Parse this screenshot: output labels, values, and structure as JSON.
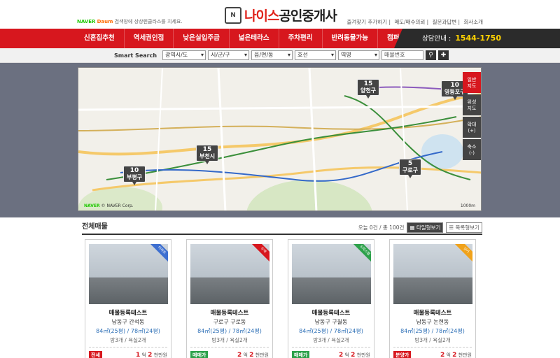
{
  "header": {
    "naver_brand": "NAVER",
    "naver_sub": "Daum",
    "naver_note": "검색창에 상상렌클라스를 치세요.",
    "logo_mark": "N",
    "logo_red": "나이스",
    "logo_dark": "공인중개사",
    "links": [
      "즐겨찾기 추가하기",
      "매도/매수의뢰",
      "질문과답변",
      "회사소개"
    ]
  },
  "nav": {
    "items": [
      "신혼집추천",
      "역세권인접",
      "낮은실입주금",
      "넓은테라스",
      "주차편리",
      "반려동물가능",
      "캠퍼스인접"
    ],
    "call_label": "상담안내 :",
    "call_number": "1544-1750"
  },
  "search": {
    "label": "Smart Search",
    "selects": [
      "광역시/도",
      "시/군/구",
      "읍/면/동",
      "호선",
      "역명"
    ],
    "input_placeholder": "매물번호",
    "search_icon": "search-icon",
    "reset_icon": "plus-icon"
  },
  "map": {
    "pins": [
      {
        "count": "15",
        "name": "양천구"
      },
      {
        "count": "10",
        "name": "영등포구"
      },
      {
        "count": "15",
        "name": "부천시"
      },
      {
        "count": "10",
        "name": "부평구"
      },
      {
        "count": "5",
        "name": "구로구"
      }
    ],
    "buttons": [
      "일반\n지도",
      "위성\n지도",
      "확대\n(+)",
      "축소\n(-)"
    ],
    "naver_logo": "NAVER",
    "naver_corp": "© NAVER Corp.",
    "scale": "1000m"
  },
  "list": {
    "title": "전체매물",
    "count_text": "오늘 0건 / 총 100건",
    "view_tile": "타일형보기",
    "view_list": "목록형보기"
  },
  "cards": [
    {
      "ribbon": "아파트",
      "ribbon_color": "#3d6fd0",
      "title": "매물등록테스트",
      "loc": "남동구 간석동",
      "area": "84㎡(25평) / 78㎡(24평)",
      "rooms": "방3개 / 욕실2개",
      "p1_tag": "전세",
      "p1_color": "#d7171e",
      "p1_a": "1",
      "p1_u1": "억",
      "p1_b": "2",
      "p1_u2": "천만원",
      "p2_tag": "월세",
      "p2_color": "#3d6fd0",
      "p2_a": "50",
      "p2_u1": "만원",
      "p2_b": "",
      "p2_u2": ""
    },
    {
      "ribbon": "주택",
      "ribbon_color": "#d7171e",
      "title": "매물등록테스트",
      "loc": "구로구 구로동",
      "area": "84㎡(25평) / 78㎡(24평)",
      "rooms": "방3개 / 욕실2개",
      "p1_tag": "매매가",
      "p1_color": "#2ca14a",
      "p1_a": "2",
      "p1_u1": "억",
      "p1_b": "2",
      "p1_u2": "천만원",
      "p2_tag": "인수금",
      "p2_color": "#14a3a8",
      "p2_a": "3",
      "p2_u1": "억",
      "p2_b": "",
      "p2_u2": ""
    },
    {
      "ribbon": "오피스텔",
      "ribbon_color": "#2ca14a",
      "title": "매물등록테스트",
      "loc": "남동구 구월동",
      "area": "84㎡(25평) / 78㎡(24평)",
      "rooms": "방3개 / 욕실2개",
      "p1_tag": "매매가",
      "p1_color": "#2ca14a",
      "p1_a": "2",
      "p1_u1": "억",
      "p1_b": "2",
      "p1_u2": "천만원",
      "p2_tag": "인수금",
      "p2_color": "#14a3a8",
      "p2_a": "3",
      "p2_u1": "억",
      "p2_b": "",
      "p2_u2": ""
    },
    {
      "ribbon": "상가",
      "ribbon_color": "#f0a21b",
      "title": "매물등록테스트",
      "loc": "남동구 논현동",
      "area": "84㎡(25평) / 78㎡(24평)",
      "rooms": "방3개 / 욕실2개",
      "p1_tag": "분양가",
      "p1_color": "#d7171e",
      "p1_a": "2",
      "p1_u1": "억",
      "p1_b": "2",
      "p1_u2": "천만원",
      "p2_tag": "인수금",
      "p2_color": "#14a3a8",
      "p2_a": "3",
      "p2_u1": "억",
      "p2_b": "",
      "p2_u2": ""
    }
  ]
}
